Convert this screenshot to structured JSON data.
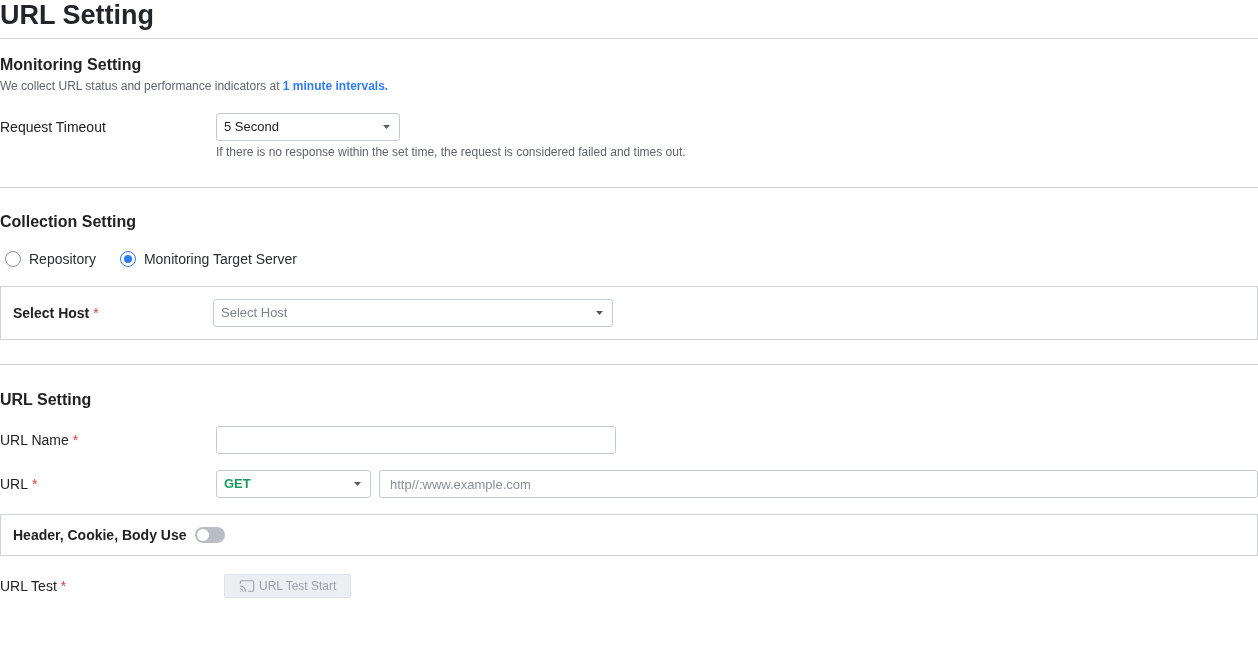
{
  "page_title": "URL Setting",
  "monitoring_setting": {
    "heading": "Monitoring Setting",
    "description": "We collect URL status and performance indicators at **1 minute intervals.**",
    "request_timeout": {
      "label": "Request Timeout",
      "value": "5 Second",
      "help": "If there is no response within the set time, the request is considered failed and times out."
    }
  },
  "collection_setting": {
    "heading": "Collection Setting",
    "options": [
      {
        "label": "Repository",
        "selected": false
      },
      {
        "label": "Monitoring Target Server",
        "selected": true
      }
    ],
    "host": {
      "label": "Select Host",
      "required_mark": "*",
      "placeholder": "Select Host"
    }
  },
  "url_setting": {
    "heading": "URL Setting",
    "fields": [
      {
        "kind": "text",
        "label": "URL Name",
        "required_mark": "*"
      },
      {
        "kind": "url",
        "label": "URL",
        "required_mark": "*",
        "method": "GET",
        "placeholder": "http//:www.example.com"
      }
    ],
    "advanced": {
      "label": "Header, Cookie, Body Use",
      "on": false
    },
    "test": {
      "label": "URL Test",
      "required_mark": "*",
      "button": "URL Test Start",
      "disabled": true
    }
  }
}
